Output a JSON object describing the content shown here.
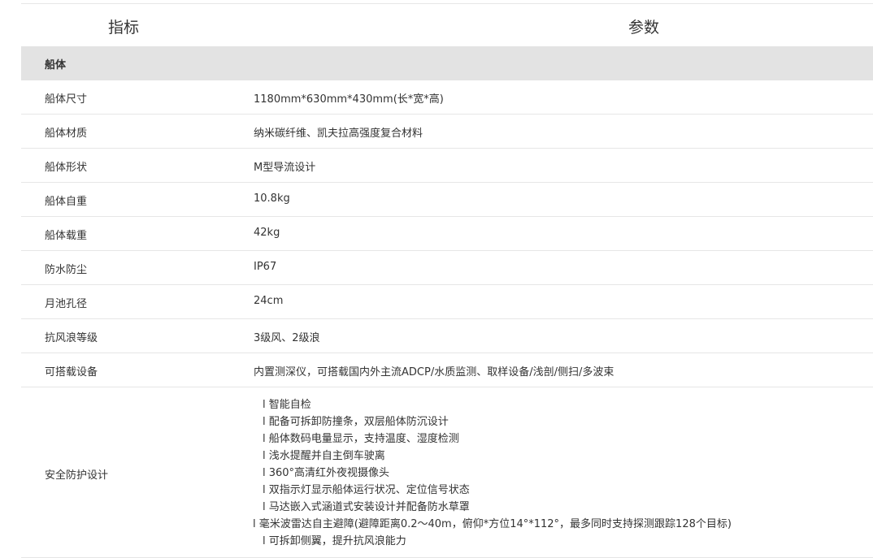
{
  "header": {
    "col1": "指标",
    "col2": "参数"
  },
  "section_title": "船体",
  "rows": [
    {
      "key": "船体尺寸",
      "value": "1180mm*630mm*430mm(长*宽*高)"
    },
    {
      "key": "船体材质",
      "value": "纳米碳纤维、凯夫拉高强度复合材料"
    },
    {
      "key": "船体形状",
      "value": "M型导流设计"
    },
    {
      "key": "船体自重",
      "value": "10.8kg"
    },
    {
      "key": "船体载重",
      "value": "42kg"
    },
    {
      "key": "防水防尘",
      "value": "IP67"
    },
    {
      "key": "月池孔径",
      "value": "24cm"
    },
    {
      "key": "抗风浪等级",
      "value": "3级风、2级浪"
    },
    {
      "key": "可搭载设备",
      "value": "内置测深仪，可搭载国内外主流ADCP/水质监测、取样设备/浅剖/侧扫/多波束"
    }
  ],
  "safety": {
    "key": "安全防护设计",
    "items": [
      "l 智能自检",
      "l 配备可拆卸防撞条，双层船体防沉设计",
      "l 船体数码电量显示，支持温度、湿度检测",
      "l 浅水提醒并自主倒车驶离",
      "l 360°高清红外夜视摄像头",
      "l 双指示灯显示船体运行状况、定位信号状态",
      "l 马达嵌入式涵道式安装设计并配备防水草罩",
      "l 毫米波雷达自主避障(避障距离0.2～40m，俯仰*方位14°*112°，最多同时支持探测跟踪128个目标)",
      "l 可拆卸侧翼，提升抗风浪能力"
    ]
  }
}
